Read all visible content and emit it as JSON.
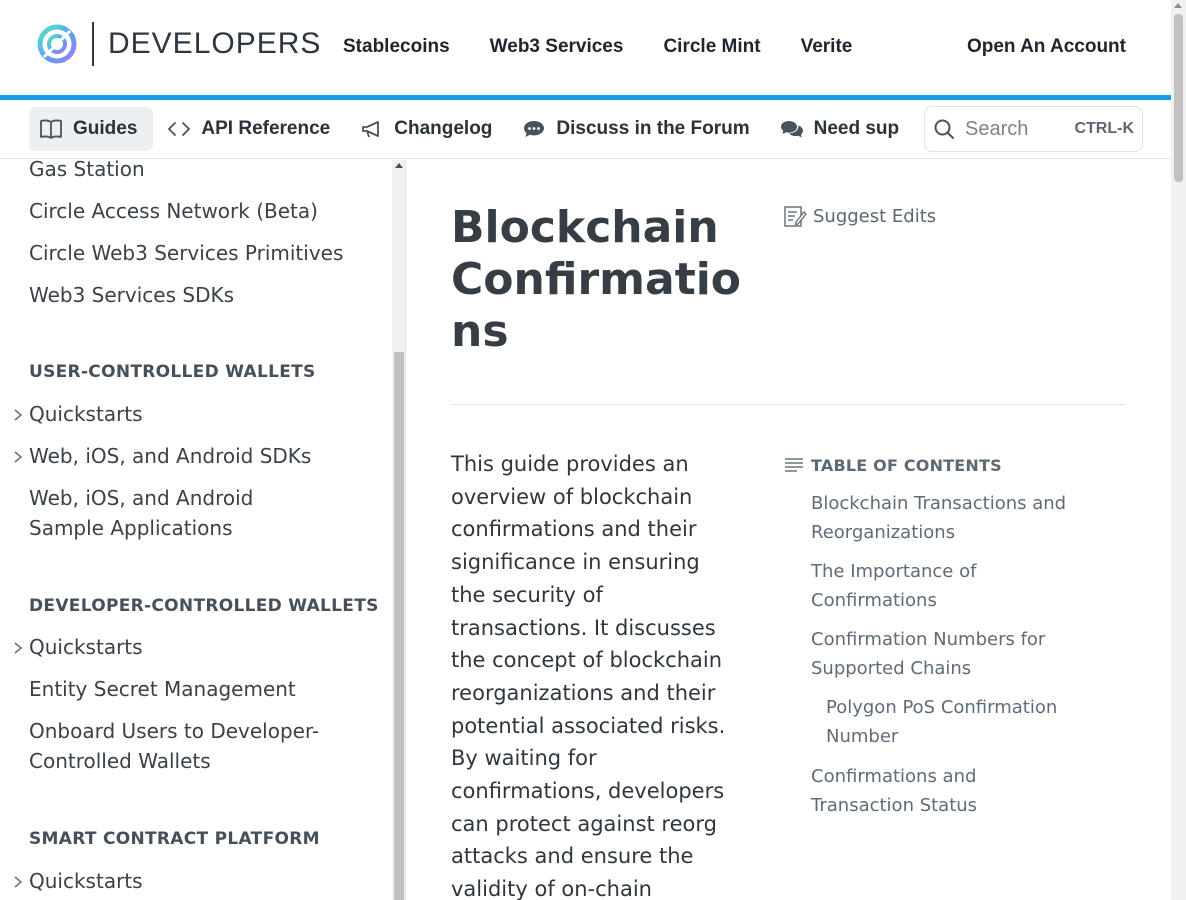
{
  "header": {
    "logo_text": "DEVELOPERS",
    "nav": [
      "Stablecoins",
      "Web3 Services",
      "Circle Mint",
      "Verite"
    ],
    "cta": "Open An Account",
    "accent_color": "#1a9be8"
  },
  "subnav": {
    "items": [
      {
        "label": "Guides",
        "icon": "book-icon",
        "active": true
      },
      {
        "label": "API Reference",
        "icon": "code-icon",
        "active": false
      },
      {
        "label": "Changelog",
        "icon": "megaphone-icon",
        "active": false
      },
      {
        "label": "Discuss in the Forum",
        "icon": "chat-bubble-icon",
        "active": false
      },
      {
        "label": "Need sup",
        "icon": "chat-bubbles-icon",
        "active": false
      }
    ],
    "search": {
      "placeholder": "Search",
      "shortcut": "CTRL-K"
    }
  },
  "sidebar": {
    "items": [
      {
        "label": "Gas Station"
      },
      {
        "label": "Circle Access Network (Beta)"
      },
      {
        "label": "Circle Web3 Services Primitives"
      },
      {
        "label": "Web3 Services SDKs"
      }
    ],
    "sections": [
      {
        "heading": "USER-CONTROLLED WALLETS",
        "items": [
          {
            "label": "Quickstarts",
            "expandable": true
          },
          {
            "label": "Web, iOS, and Android SDKs",
            "expandable": true
          },
          {
            "label": "Web, iOS, and Android Sample Applications",
            "expandable": false
          }
        ]
      },
      {
        "heading": "DEVELOPER-CONTROLLED WALLETS",
        "items": [
          {
            "label": "Quickstarts",
            "expandable": true
          },
          {
            "label": "Entity Secret Management",
            "expandable": false
          },
          {
            "label": "Onboard Users to Developer-Controlled Wallets",
            "expandable": false
          }
        ]
      },
      {
        "heading": "SMART CONTRACT PLATFORM",
        "items": [
          {
            "label": "Quickstarts",
            "expandable": true
          }
        ]
      }
    ]
  },
  "main": {
    "title": "Blockchain Confirmations",
    "suggest_edits": "Suggest Edits",
    "intro": "This guide provides an overview of blockchain confirmations and their significance in ensuring the security of transactions. It discusses the concept of blockchain reorganizations and their potential associated risks. By waiting for confirmations, developers can protect against reorg attacks and ensure the validity of on-chain transactions.",
    "toc": {
      "heading": "TABLE OF CONTENTS",
      "items": [
        {
          "label": "Blockchain Transactions and Reorganizations",
          "level": 1
        },
        {
          "label": "The Importance of Confirmations",
          "level": 1
        },
        {
          "label": "Confirmation Numbers for Supported Chains",
          "level": 1
        },
        {
          "label": "Polygon PoS Confirmation Number",
          "level": 2
        },
        {
          "label": "Confirmations and Transaction Status",
          "level": 1
        }
      ]
    }
  }
}
